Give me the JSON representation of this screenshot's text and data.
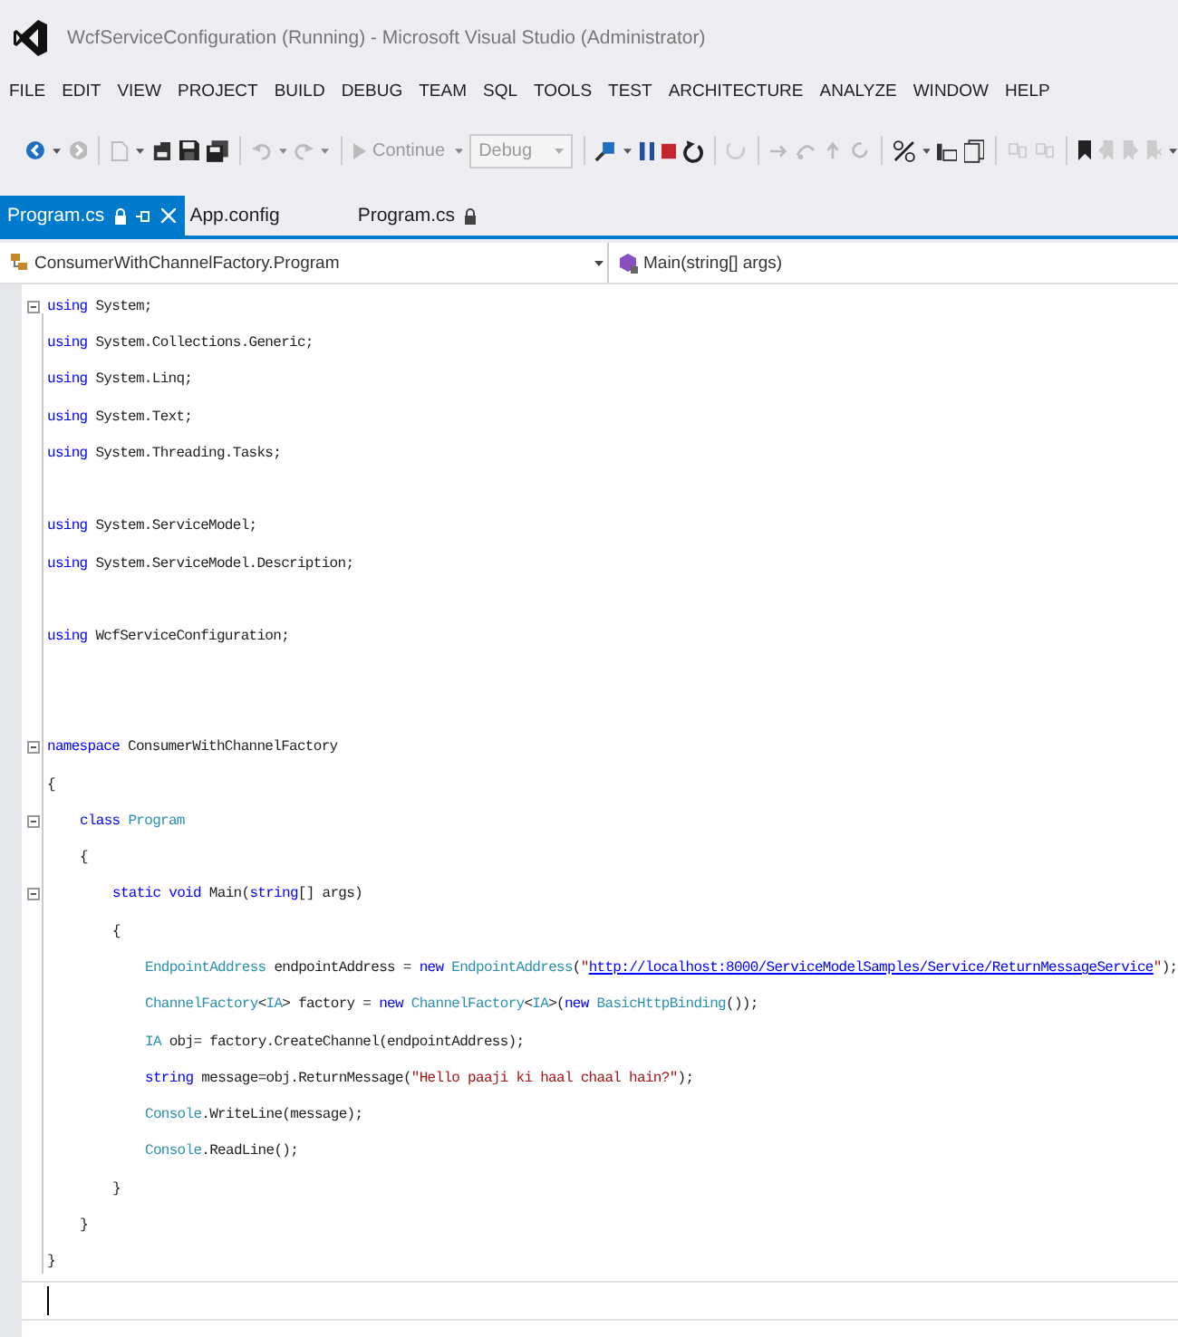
{
  "window": {
    "title": "WcfServiceConfiguration (Running) - Microsoft Visual Studio (Administrator)"
  },
  "menu": [
    "FILE",
    "EDIT",
    "VIEW",
    "PROJECT",
    "BUILD",
    "DEBUG",
    "TEAM",
    "SQL",
    "TOOLS",
    "TEST",
    "ARCHITECTURE",
    "ANALYZE",
    "WINDOW",
    "HELP"
  ],
  "toolbar": {
    "continue_button": "Continue",
    "configuration_dropdown": "Debug"
  },
  "tabs": [
    {
      "label": "Program.cs",
      "selected": true,
      "locked": true,
      "pinnable": true
    },
    {
      "label": "App.config",
      "selected": false,
      "locked": false,
      "pinnable": false
    },
    {
      "label": "Program.cs",
      "selected": false,
      "locked": true,
      "pinnable": false
    }
  ],
  "navigation_bar": {
    "type_dropdown": "ConsumerWithChannelFactory.Program",
    "member_dropdown": "Main(string[] args)"
  },
  "code": [
    {
      "kind": "code",
      "fold": true,
      "tokens": [
        {
          "kind": "keyword",
          "text": "using"
        },
        {
          "kind": "plain",
          "text": " System;"
        }
      ]
    },
    {
      "kind": "code",
      "fold": false,
      "tokens": [
        {
          "kind": "keyword",
          "text": "using"
        },
        {
          "kind": "plain",
          "text": " System.Collections.Generic;"
        }
      ]
    },
    {
      "kind": "code",
      "fold": false,
      "tokens": [
        {
          "kind": "keyword",
          "text": "using"
        },
        {
          "kind": "plain",
          "text": " System.Linq;"
        }
      ]
    },
    {
      "kind": "code",
      "fold": false,
      "tokens": [
        {
          "kind": "keyword",
          "text": "using"
        },
        {
          "kind": "plain",
          "text": " System.Text;"
        }
      ]
    },
    {
      "kind": "code",
      "fold": false,
      "tokens": [
        {
          "kind": "keyword",
          "text": "using"
        },
        {
          "kind": "plain",
          "text": " System.Threading.Tasks;"
        }
      ]
    },
    {
      "kind": "blank"
    },
    {
      "kind": "code",
      "fold": false,
      "tokens": [
        {
          "kind": "keyword",
          "text": "using"
        },
        {
          "kind": "plain",
          "text": " System.ServiceModel;"
        }
      ]
    },
    {
      "kind": "code",
      "fold": false,
      "tokens": [
        {
          "kind": "keyword",
          "text": "using"
        },
        {
          "kind": "plain",
          "text": " System.ServiceModel.Description;"
        }
      ]
    },
    {
      "kind": "blank"
    },
    {
      "kind": "code",
      "fold": false,
      "tokens": [
        {
          "kind": "keyword",
          "text": "using"
        },
        {
          "kind": "plain",
          "text": " WcfServiceConfiguration;"
        }
      ]
    },
    {
      "kind": "blank"
    },
    {
      "kind": "blank"
    },
    {
      "kind": "code",
      "fold": true,
      "tokens": [
        {
          "kind": "keyword",
          "text": "namespace"
        },
        {
          "kind": "plain",
          "text": " ConsumerWithChannelFactory"
        }
      ]
    },
    {
      "kind": "code",
      "fold": false,
      "tokens": [
        {
          "kind": "plain",
          "text": "{"
        }
      ],
      "children": [
        {
          "kind": "code",
          "fold": true,
          "tokens": [
            {
              "kind": "keyword",
              "text": "class"
            },
            {
              "kind": "type",
              "text": " Program"
            }
          ]
        },
        {
          "kind": "code",
          "fold": false,
          "tokens": [
            {
              "kind": "plain",
              "text": "{"
            }
          ],
          "children": [
            {
              "kind": "code",
              "fold": true,
              "tokens": [
                {
                  "kind": "keyword",
                  "text": "static void"
                },
                {
                  "kind": "plain",
                  "text": " Main("
                },
                {
                  "kind": "keyword",
                  "text": "string"
                },
                {
                  "kind": "plain",
                  "text": "[] args)"
                }
              ]
            },
            {
              "kind": "code",
              "fold": false,
              "tokens": [
                {
                  "kind": "plain",
                  "text": "{"
                }
              ],
              "children": [
                {
                  "kind": "code",
                  "fold": false,
                  "tokens": [
                    {
                      "kind": "type",
                      "text": "EndpointAddress"
                    },
                    {
                      "kind": "plain",
                      "text": " endpointAddress = "
                    },
                    {
                      "kind": "keyword",
                      "text": "new"
                    },
                    {
                      "kind": "type",
                      "text": " EndpointAddress"
                    },
                    {
                      "kind": "plain",
                      "text": "("
                    },
                    {
                      "kind": "string",
                      "text": "\""
                    },
                    {
                      "kind": "link",
                      "text": "http://localhost:8000/ServiceModelSamples/Service/ReturnMessageService"
                    },
                    {
                      "kind": "string",
                      "text": "\""
                    },
                    {
                      "kind": "plain",
                      "text": ");"
                    }
                  ]
                },
                {
                  "kind": "code",
                  "fold": false,
                  "tokens": [
                    {
                      "kind": "type",
                      "text": "ChannelFactory"
                    },
                    {
                      "kind": "plain",
                      "text": "<"
                    },
                    {
                      "kind": "type",
                      "text": "IA"
                    },
                    {
                      "kind": "plain",
                      "text": "> factory = "
                    },
                    {
                      "kind": "keyword",
                      "text": "new"
                    },
                    {
                      "kind": "type",
                      "text": " ChannelFactory"
                    },
                    {
                      "kind": "plain",
                      "text": "<"
                    },
                    {
                      "kind": "type",
                      "text": "IA"
                    },
                    {
                      "kind": "plain",
                      "text": ">("
                    },
                    {
                      "kind": "keyword",
                      "text": "new"
                    },
                    {
                      "kind": "type",
                      "text": " BasicHttpBinding"
                    },
                    {
                      "kind": "plain",
                      "text": "());"
                    }
                  ]
                },
                {
                  "kind": "code",
                  "fold": false,
                  "tokens": [
                    {
                      "kind": "type",
                      "text": "IA"
                    },
                    {
                      "kind": "plain",
                      "text": " obj= factory.CreateChannel(endpointAddress);"
                    }
                  ]
                },
                {
                  "kind": "code",
                  "fold": false,
                  "tokens": [
                    {
                      "kind": "keyword",
                      "text": "string"
                    },
                    {
                      "kind": "plain",
                      "text": " message=obj.ReturnMessage("
                    },
                    {
                      "kind": "string",
                      "text": "\"Hello paaji ki haal chaal hain?\""
                    },
                    {
                      "kind": "plain",
                      "text": ");"
                    }
                  ]
                },
                {
                  "kind": "code",
                  "fold": false,
                  "tokens": [
                    {
                      "kind": "type",
                      "text": "Console"
                    },
                    {
                      "kind": "plain",
                      "text": ".WriteLine(message);"
                    }
                  ]
                },
                {
                  "kind": "code",
                  "fold": false,
                  "tokens": [
                    {
                      "kind": "type",
                      "text": "Console"
                    },
                    {
                      "kind": "plain",
                      "text": ".ReadLine();"
                    }
                  ]
                }
              ]
            },
            {
              "kind": "code",
              "fold": false,
              "tokens": [
                {
                  "kind": "plain",
                  "text": "}"
                }
              ]
            }
          ]
        },
        {
          "kind": "code",
          "fold": false,
          "tokens": [
            {
              "kind": "plain",
              "text": "}"
            }
          ]
        }
      ]
    },
    {
      "kind": "code",
      "fold": false,
      "tokens": [
        {
          "kind": "plain",
          "text": "}"
        }
      ]
    }
  ]
}
